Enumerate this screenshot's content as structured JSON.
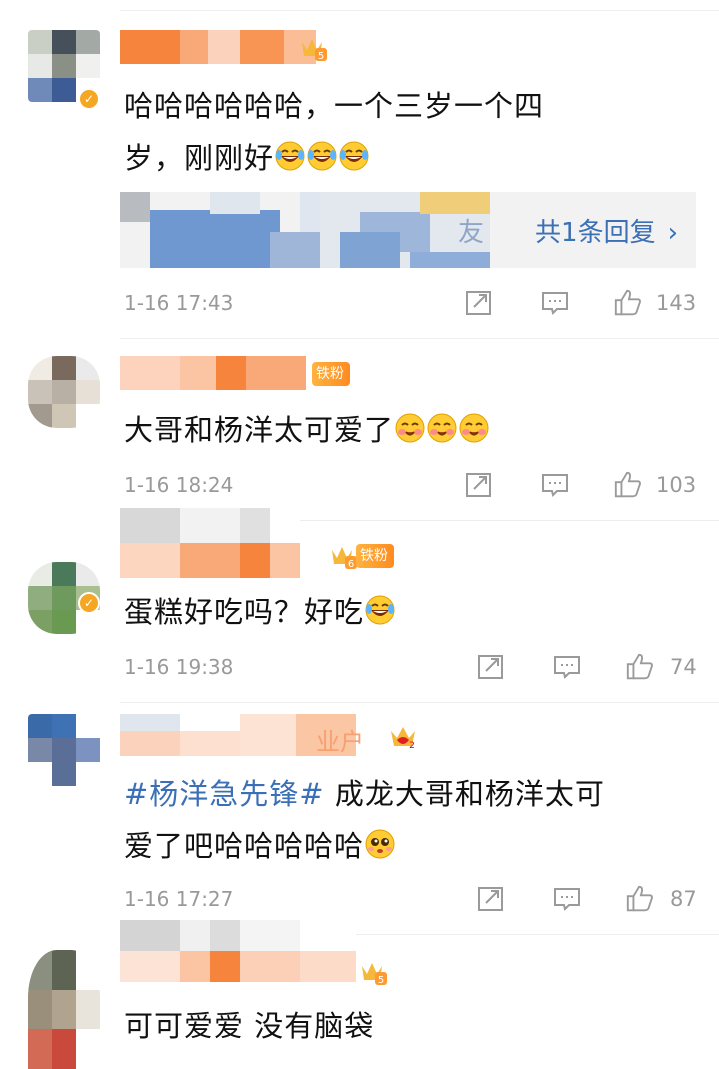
{
  "comments": [
    {
      "text": "哈哈哈哈哈哈，一个三岁一个四岁，刚刚好",
      "text_line1": "哈哈哈哈哈哈，一个三岁一个四",
      "text_line2": "岁，刚刚好",
      "emojis": [
        "laugh-cry",
        "laugh-cry",
        "laugh-cry"
      ],
      "reply_label": "共1条回复",
      "reply_fragment": "友",
      "time": "1-16 17:43",
      "likes": "143",
      "level_badge": "5"
    },
    {
      "text": "大哥和杨洋太可爱了",
      "emojis": [
        "blush",
        "blush",
        "blush"
      ],
      "fan_badge": "铁粉",
      "time": "1-16 18:24",
      "likes": "103"
    },
    {
      "text": "蛋糕好吃吗？好吃",
      "emojis": [
        "laugh-cry"
      ],
      "fan_badge": "铁粉",
      "time": "1-16 19:38",
      "likes": "74",
      "level_badge": "6"
    },
    {
      "hashtag": "#杨洋急先锋#",
      "text_line1_rest": "成龙大哥和杨洋太可",
      "text_line2": "爱了吧哈哈哈哈哈",
      "emojis": [
        "cute-face"
      ],
      "name_fragment": "业户",
      "time": "1-16 17:27",
      "likes": "87",
      "level_badge": "2"
    },
    {
      "text": "可可爱爱 没有脑袋",
      "time": "",
      "likes": "",
      "level_badge": "5"
    }
  ],
  "icons": {
    "share": "share-icon",
    "comment": "comment-icon",
    "like": "like-icon",
    "chevron": "›"
  },
  "colors": {
    "link": "#3b6fb6",
    "meta": "#999999",
    "badge": "#ff8b1f"
  }
}
